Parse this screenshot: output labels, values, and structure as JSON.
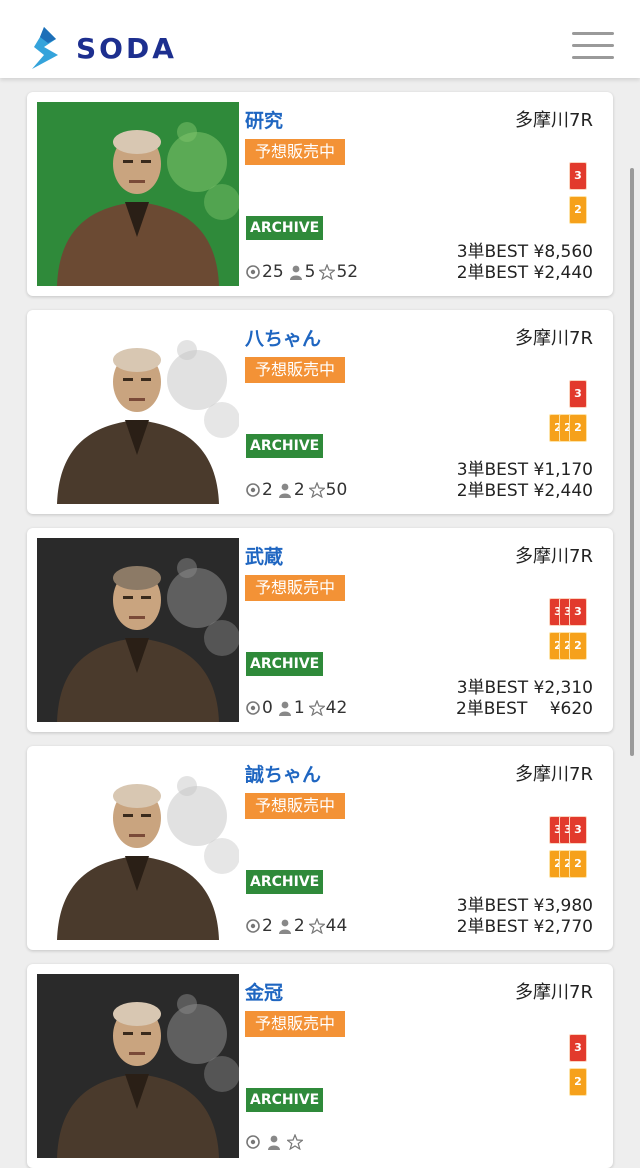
{
  "header": {
    "logo_text": "SODA",
    "menu_icon": "hamburger-menu-icon"
  },
  "cards": [
    {
      "name": "研究",
      "sale_label": "予想販売中",
      "archive_label": "ARCHIVE",
      "venue": "多摩川7R",
      "stats": {
        "hits": "25",
        "followers": "5",
        "favorites": "52"
      },
      "tickets": {
        "san_count": 1,
        "ni_count": 1
      },
      "best_lines": [
        "3単BEST ¥8,560",
        "2単BEST ¥2,440"
      ],
      "photo_bg": "#2f8a3a"
    },
    {
      "name": "八ちゃん",
      "sale_label": "予想販売中",
      "archive_label": "ARCHIVE",
      "venue": "多摩川7R",
      "stats": {
        "hits": "2",
        "followers": "2",
        "favorites": "50"
      },
      "tickets": {
        "san_count": 1,
        "ni_count": 3
      },
      "best_lines": [
        "3単BEST ¥1,170",
        "2単BEST ¥2,440"
      ],
      "photo_bg": "#ffffff"
    },
    {
      "name": "武蔵",
      "sale_label": "予想販売中",
      "archive_label": "ARCHIVE",
      "venue": "多摩川7R",
      "stats": {
        "hits": "0",
        "followers": "1",
        "favorites": "42"
      },
      "tickets": {
        "san_count": 3,
        "ni_count": 3
      },
      "best_lines": [
        "3単BEST ¥2,310",
        "2単BEST　 ¥620"
      ],
      "photo_bg": "#2a2a2a"
    },
    {
      "name": "誠ちゃん",
      "sale_label": "予想販売中",
      "archive_label": "ARCHIVE",
      "venue": "多摩川7R",
      "stats": {
        "hits": "2",
        "followers": "2",
        "favorites": "44"
      },
      "tickets": {
        "san_count": 3,
        "ni_count": 3
      },
      "best_lines": [
        "3単BEST ¥3,980",
        "2単BEST ¥2,770"
      ],
      "photo_bg": "#ffffff"
    },
    {
      "name": "金冠",
      "sale_label": "予想販売中",
      "archive_label": "ARCHIVE",
      "venue": "多摩川7R",
      "stats": {
        "hits": "",
        "followers": "",
        "favorites": ""
      },
      "tickets": {
        "san_count": 1,
        "ni_count": 1
      },
      "best_lines": [
        "",
        ""
      ],
      "photo_bg": "#2a2a2a"
    }
  ],
  "ticket_labels": {
    "san": "3単",
    "ni": "2単"
  },
  "colors": {
    "brand": "#1d2f8f",
    "name_blue": "#1f66c1",
    "sale_orange": "#f39236",
    "archive_green": "#2f8a3a",
    "ticket_red": "#e23a2c",
    "ticket_orange": "#f6a11b"
  }
}
